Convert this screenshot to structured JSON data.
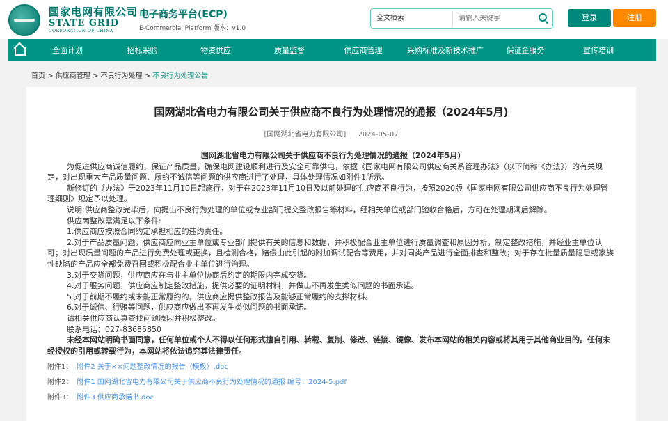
{
  "header": {
    "brand_cn": "国家电网有限公司",
    "brand_en": "STATE GRID",
    "brand_en2": "CORPORATION OF CHINA",
    "platform_title": "电子商务平台(ECP)",
    "platform_sub": "E-Commercial Platform 版本：v1.0",
    "search_type": "全文检索",
    "search_placeholder": "请输入关键字",
    "login": "登录",
    "register": "注册"
  },
  "nav": [
    "全面计划",
    "招标采购",
    "物资供应",
    "质量监督",
    "供应商管理",
    "采购标准及新技术推广",
    "保证金服务",
    "宣传培训"
  ],
  "breadcrumb": [
    "首页",
    "供应商管理",
    "不良行为处理",
    "不良行为处理公告"
  ],
  "article": {
    "title": "国网湖北省电力有限公司关于供应商不良行为处理情况的通报（2024年5月)",
    "source": "[国网湖北省电力有限公司]",
    "date": "2024-05-07",
    "content_title": "国网湖北省电力有限公司关于供应商不良行为处理情况的通报（2024年5月)",
    "paragraphs": [
      "为促进供应商诚信履约，保证产品质量，确保电网建设顺利进行及安全可靠供电，依据《国家电网有限公司供应商关系管理办法》（以下简称《办法》）的有关规定，对出现重大产品质量问题、履约不诚信等问题的供应商进行了处理，具体处理情况如附件1所示。",
      "新修订的《办法》于2023年11月10日起施行，对于在2023年11月10日及以前处理的供应商不良行为，按照2020版《国家电网有限公司供应商不良行为处理管理细则》规定予以处理。",
      "说明:供应商整改完毕后，向提出不良行为处理的单位或专业部门提交整改报告等材料，经相关单位或部门验收合格后，方可在处理期满后解除。",
      "供应商整改需满足以下条件:",
      "1.供应商应按照合同约定承担相应的违约责任。",
      "2.对于产品质量问题，供应商应向业主单位或专业部门提供有关的信息和数据，并积极配合业主单位进行质量调查和原因分析，制定整改措施，并经业主单位认可；对出现质量问题的产品进行免费处理或更换，且检测合格，赔偿由此引起的附加调试配合等费用，并对同类产品进行全面排查和整改；对于存在批量质量隐患或家族性缺陷的产品应全部免费召回或积极配合业主单位进行治理。",
      "3.对于交货问题，供应商应在与业主单位协商后约定的期限内完成交货。",
      "4.对于服务问题，供应商应制定整改措施，提供必要的证明材料，并做出不再发生类似问题的书面承诺。",
      "5.对于前期不履约或未能正常履约的，供应商应提供整改报告及能够正常履约的支撑材料。",
      "6.对于诚信、行贿等问题，供应商应做出不再发生类似问题的书面承诺。",
      "请相关供应商认真查找问题原因并积极整改。",
      "联系电话：027-83685850"
    ],
    "disclaimer": "未经本网站明确书面同意，任何单位或个人不得以任何形式擅自引用、转载、复制、修改、链接、镜像、发布本网站的相关内容或将其用于其他商业目的。任何未经授权的引用或转载行为，本网站将依法追究其法律责任。",
    "attachments": [
      {
        "label": "附件1：",
        "name": "附件2 关于××问题整改情况的报告（模板）.doc"
      },
      {
        "label": "附件2：",
        "name": "附件1 国网湖北省电力有限公司关于供应商不良行为处理情况的通报 编号：2024-5.pdf"
      },
      {
        "label": "附件3：",
        "name": "附件3 供应商承诺书.doc"
      }
    ]
  }
}
